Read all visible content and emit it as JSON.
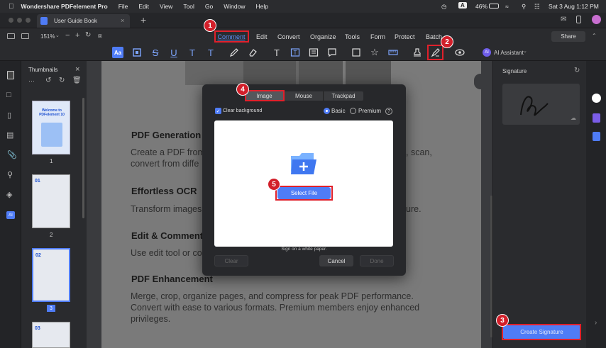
{
  "menubar": {
    "app_name": "Wondershare PDFelement Pro",
    "items": [
      "File",
      "Edit",
      "View",
      "Tool",
      "Go",
      "Window",
      "Help"
    ],
    "battery": "46%",
    "datetime": "Sat 3 Aug  1:12 PM",
    "input_indicator": "A"
  },
  "tab": {
    "title": "User Guide Book",
    "add": "+"
  },
  "toolbar": {
    "zoom": "151%",
    "minus": "−",
    "plus": "+",
    "menus": [
      "Comment",
      "Edit",
      "Convert",
      "Organize",
      "Tools",
      "Form",
      "Protect",
      "Batch"
    ],
    "share": "Share",
    "ai_assistant": "AI Assistant",
    "ai_badge": "AI"
  },
  "thumbnails": {
    "title": "Thumbnails",
    "close": "×",
    "more": "···",
    "pages": [
      {
        "label": "1",
        "header": "Welcome to PDFelement 10"
      },
      {
        "label": "2",
        "header": "01"
      },
      {
        "label": "3",
        "header": "02"
      },
      {
        "label": "",
        "header": "03"
      }
    ]
  },
  "leftrail": {
    "ai_label": "AI"
  },
  "document": {
    "sections": [
      {
        "heading": "PDF Generation",
        "body": [
          "Create a PDF from",
          "convert from diffe"
        ],
        "body_right": ", scan,"
      },
      {
        "heading": "Effortless OCR",
        "body": [
          "Transform images"
        ],
        "body_right": "ure."
      },
      {
        "heading": "Edit & Comment",
        "body": [
          "Use edit tool or co"
        ],
        "body_right": ""
      },
      {
        "heading": "PDF Enhancement",
        "body": [
          "Merge, crop, organize pages, and compress for peak PDF performance.",
          "Convert with ease to various formats. Premium members enjoy enhanced",
          "privileges."
        ],
        "body_right": ""
      }
    ]
  },
  "dialog": {
    "tabs": [
      "Image",
      "Mouse",
      "Trackpad"
    ],
    "clear_background": "Clear background",
    "basic": "Basic",
    "premium": "Premium",
    "help": "?",
    "select_file": "Select File",
    "hint": "Sign on a white paper.",
    "clear": "Clear",
    "cancel": "Cancel",
    "done": "Done"
  },
  "signature_panel": {
    "title": "Signature",
    "create": "Create Signature"
  },
  "markers": [
    "1",
    "2",
    "3",
    "4",
    "5"
  ],
  "colors": {
    "accent": "#4f7cf6",
    "marker": "#d21f2a",
    "comment_active": "#5b8ef5"
  }
}
